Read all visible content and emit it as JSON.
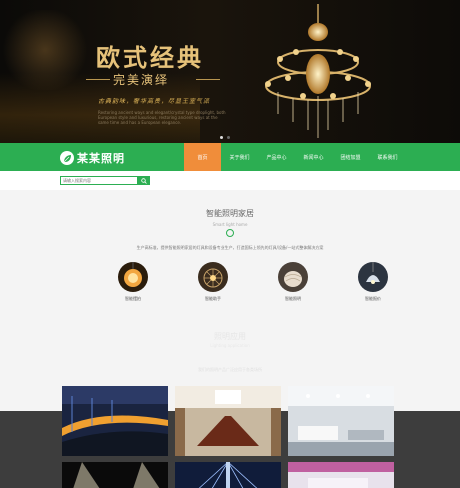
{
  "banner": {
    "title": "欧式经典",
    "subtitle": "完美演绎",
    "motto": "古典韵味，奢华高贵，尽显王室气派",
    "description": "Restoring ancient ways and elegant/crystal type droplight, both European style and luxurious, restoring ancient ways at the same time and has a European elegance.",
    "slide_count": 2,
    "active_slide": 1
  },
  "nav": {
    "logo_text": "某某照明",
    "items": [
      {
        "label": "首页",
        "active": true
      },
      {
        "label": "关于我们",
        "active": false
      },
      {
        "label": "产品中心",
        "active": false
      },
      {
        "label": "新闻中心",
        "active": false
      },
      {
        "label": "团结加盟",
        "active": false
      },
      {
        "label": "联系我们",
        "active": false
      }
    ]
  },
  "search": {
    "placeholder": "请输入搜索内容"
  },
  "section1": {
    "title": "智能照明家居",
    "subtitle": "Smart light home",
    "description": "生产高标准，提供智能照明家居的灯具和设备专业生产，打造国际上领先的灯具/设备/一站式整体解决方案",
    "features": [
      {
        "label": "智能摆拍",
        "icon": "pendant-lamp-icon"
      },
      {
        "label": "智能助手",
        "icon": "woven-lamp-icon"
      },
      {
        "label": "智能照明",
        "icon": "shell-lamp-icon"
      },
      {
        "label": "智能报价",
        "icon": "dome-lamp-icon"
      }
    ]
  },
  "section2": {
    "title": "照明应用",
    "subtitle": "Lighting application",
    "description": "我们的照明产品广泛应用于各类场所"
  },
  "colors": {
    "brand_green": "#2cae52",
    "nav_active": "#f08d3a",
    "banner_gold": "#e6c27a"
  }
}
